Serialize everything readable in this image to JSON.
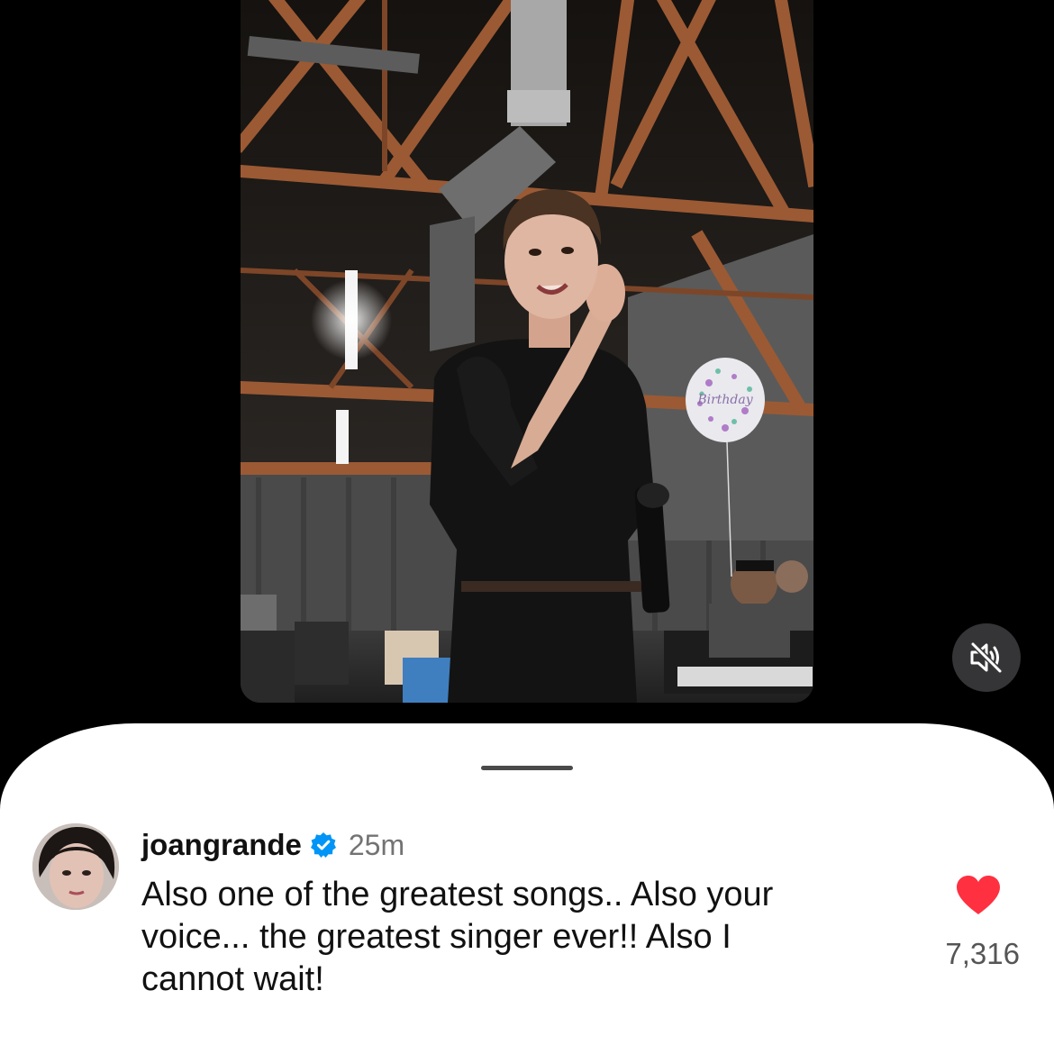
{
  "video": {
    "muted": true,
    "mute_icon": "speaker-muted-icon",
    "balloon_text": "Birthday"
  },
  "sheet": {
    "handle_icon": "grabber-handle"
  },
  "comment": {
    "username": "joangrande",
    "verified": true,
    "verified_icon": "verified-badge-icon",
    "timestamp": "25m",
    "text": "Also one of the greatest songs.. Also your\nvoice... the greatest singer ever!! Also I\ncannot wait!",
    "liked": true,
    "like_icon": "heart-icon",
    "like_count": "7,316"
  },
  "colors": {
    "like_red": "#ff3040",
    "verified_blue": "#0095f6",
    "timestamp_gray": "#737373"
  }
}
